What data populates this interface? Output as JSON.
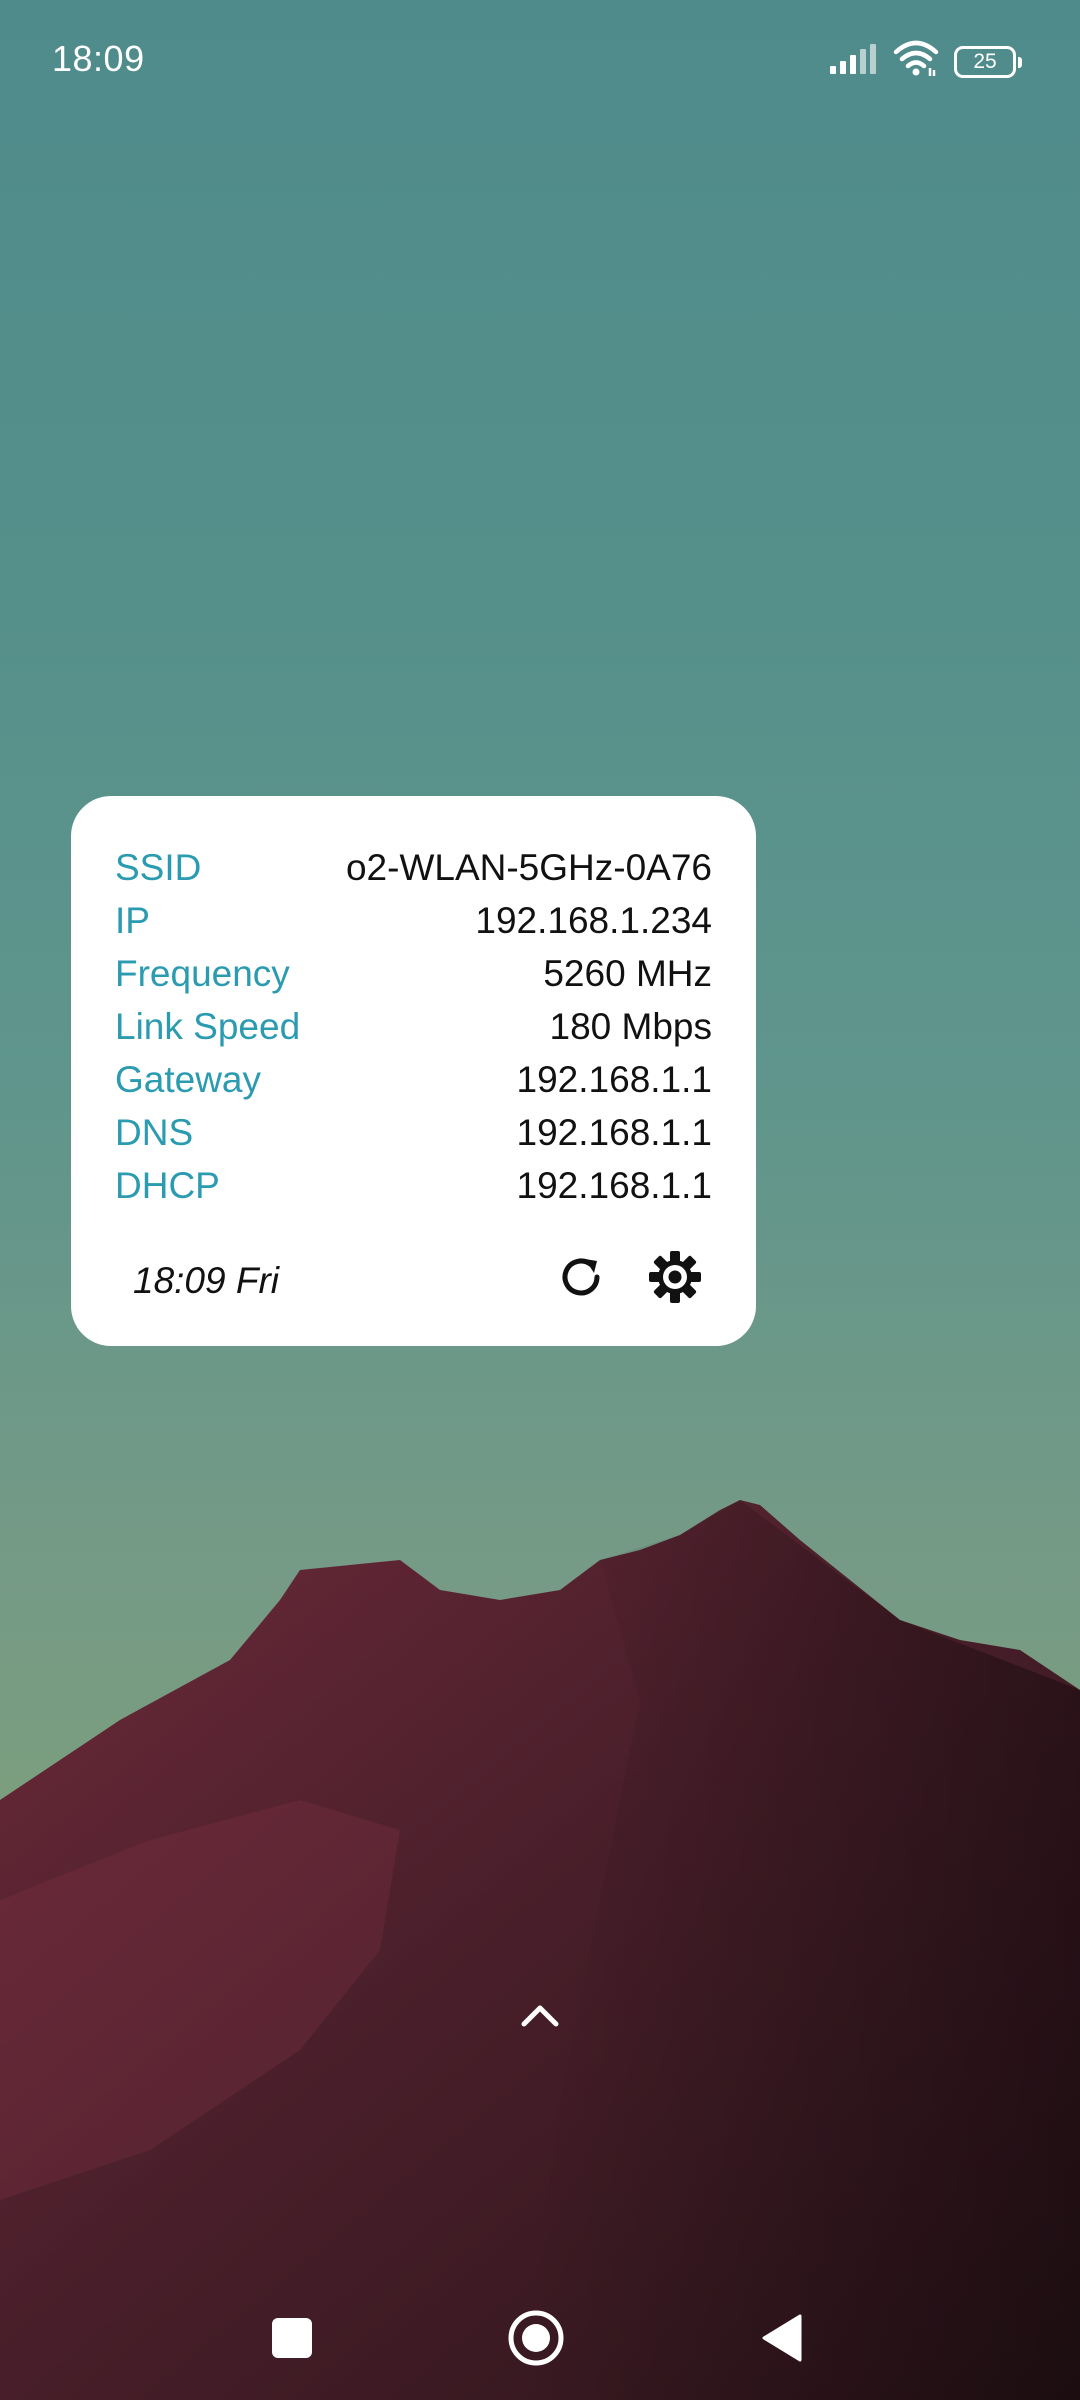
{
  "status_bar": {
    "time": "18:09",
    "battery_level": "25",
    "icons": [
      "signal-icon",
      "wifi-icon",
      "battery-icon"
    ]
  },
  "widget": {
    "rows": [
      {
        "label": "SSID",
        "value": "o2-WLAN-5GHz-0A76"
      },
      {
        "label": "IP",
        "value": "192.168.1.234"
      },
      {
        "label": "Frequency",
        "value": "5260 MHz"
      },
      {
        "label": "Link Speed",
        "value": "180 Mbps"
      },
      {
        "label": "Gateway",
        "value": "192.168.1.1"
      },
      {
        "label": "DNS",
        "value": "192.168.1.1"
      },
      {
        "label": "DHCP",
        "value": "192.168.1.1"
      }
    ],
    "footer_time": "18:09 Fri",
    "actions": [
      "refresh-icon",
      "gear-icon"
    ],
    "label_color": "#2a9bb0"
  },
  "navigation": {
    "buttons": [
      "recents-square-icon",
      "home-circle-icon",
      "back-triangle-icon"
    ]
  },
  "home": {
    "drawer_icon": "chevron-up-icon"
  }
}
